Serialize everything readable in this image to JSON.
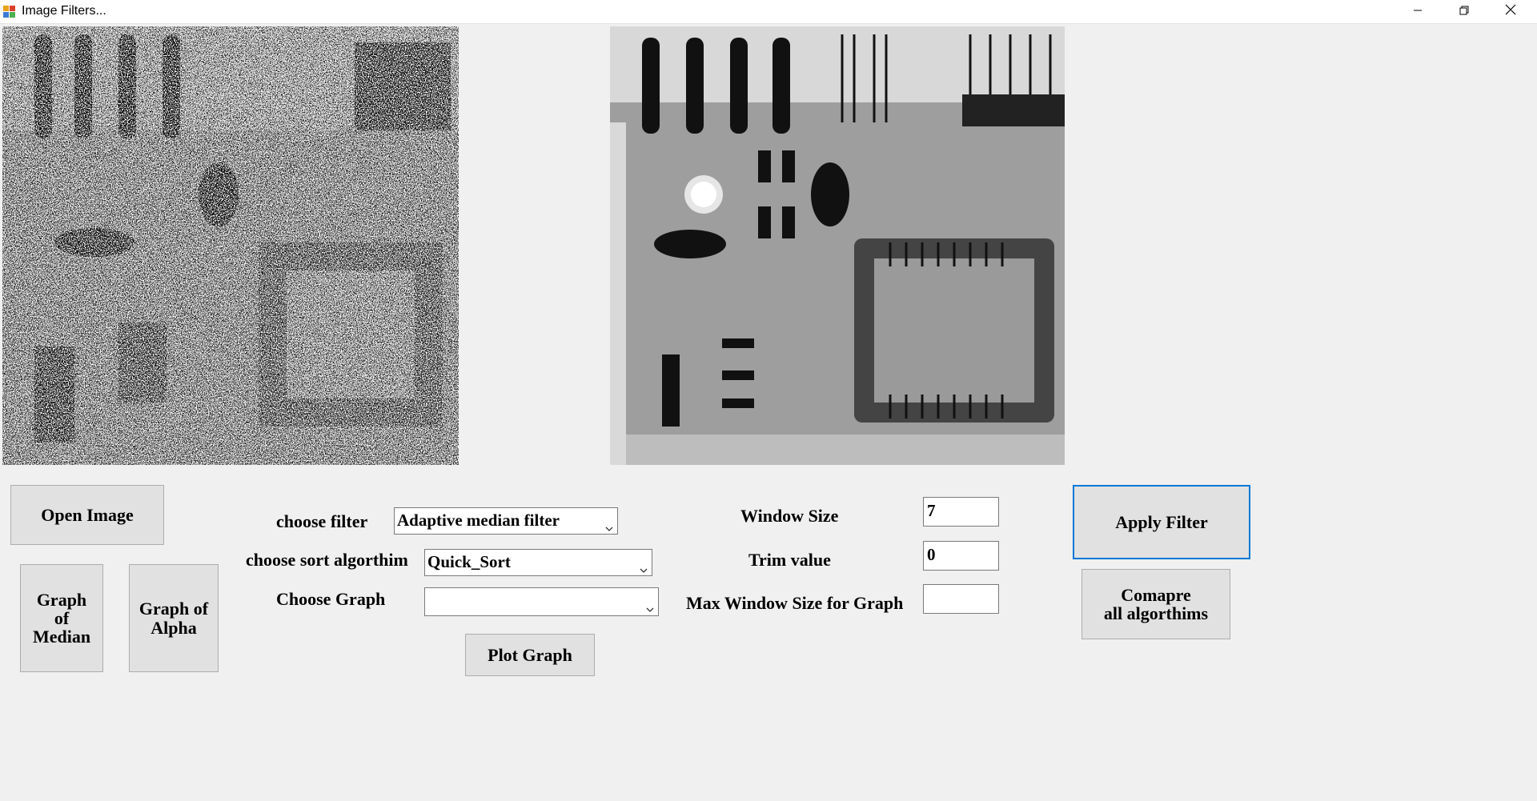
{
  "window": {
    "title": "Image Filters...",
    "app_icon": "app-window-icon",
    "controls": [
      "minimize-icon",
      "maximize-icon",
      "close-icon"
    ]
  },
  "images": {
    "original": "noisy-circuit-board-image",
    "filtered": "filtered-circuit-board-image"
  },
  "buttons": {
    "open_image": "Open Image",
    "graph_median": "Graph\nof\nMedian",
    "graph_alpha": "Graph of\nAlpha",
    "plot_graph": "Plot Graph",
    "apply_filter": "Apply Filter",
    "compare_all": "Comapre\n all algorthims"
  },
  "labels": {
    "choose_filter": "choose filter",
    "choose_sort": "choose sort algorthim",
    "choose_graph": "Choose Graph",
    "window_size": "Window Size",
    "trim_value": "Trim value",
    "max_window": "Max Window Size for Graph"
  },
  "selects": {
    "filter": "Adaptive median filter",
    "sort": "Quick_Sort",
    "graph": ""
  },
  "inputs": {
    "window_size": "7",
    "trim_value": "0",
    "max_window": ""
  },
  "colors": {
    "form_background": "#f0f0f0",
    "button_face": "#e1e1e1",
    "focus_border": "#0078d7"
  }
}
